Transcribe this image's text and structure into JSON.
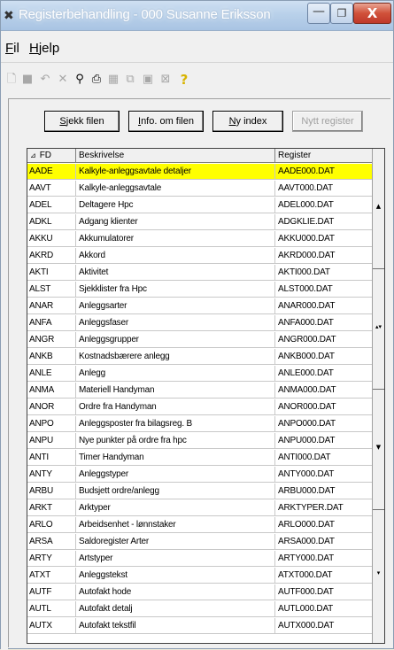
{
  "window": {
    "title": "Registerbehandling - 000 Susanne Eriksson",
    "app_icon": "x-logo-icon",
    "minimize": "—",
    "maximize": "❐",
    "close": "X"
  },
  "menu": {
    "fil_u": "F",
    "fil_rest": "il",
    "hjelp_u": "H",
    "hjelp_rest": "jelp"
  },
  "toolbar": {
    "icons": [
      "new-icon",
      "save-icon",
      "undo-icon",
      "delete-icon",
      "find-icon",
      "print-icon",
      "grid-icon",
      "copy-icon",
      "report-icon",
      "export-icon",
      "help-icon"
    ]
  },
  "buttons": {
    "sjekk_u": "S",
    "sjekk_rest": "jekk filen",
    "info_u": "I",
    "info_rest": "nfo. om filen",
    "index_u": "N",
    "index_rest": "y index",
    "nytt": "Nytt register"
  },
  "grid": {
    "columns": [
      "FD",
      "Beskrivelse",
      "Register"
    ],
    "sort_indicator": "⊿",
    "rows": [
      {
        "fd": "AADE",
        "desc": "Kalkyle-anleggsavtale detaljer",
        "reg": "AADE000.DAT"
      },
      {
        "fd": "AAVT",
        "desc": "Kalkyle-anleggsavtale",
        "reg": "AAVT000.DAT"
      },
      {
        "fd": "ADEL",
        "desc": "Deltagere Hpc",
        "reg": "ADEL000.DAT"
      },
      {
        "fd": "ADKL",
        "desc": "Adgang klienter",
        "reg": "ADGKLIE.DAT"
      },
      {
        "fd": "AKKU",
        "desc": "Akkumulatorer",
        "reg": "AKKU000.DAT"
      },
      {
        "fd": "AKRD",
        "desc": "Akkord",
        "reg": "AKRD000.DAT"
      },
      {
        "fd": "AKTI",
        "desc": "Aktivitet",
        "reg": "AKTI000.DAT"
      },
      {
        "fd": "ALST",
        "desc": "Sjekklister fra Hpc",
        "reg": "ALST000.DAT"
      },
      {
        "fd": "ANAR",
        "desc": "Anleggsarter",
        "reg": "ANAR000.DAT"
      },
      {
        "fd": "ANFA",
        "desc": "Anleggsfaser",
        "reg": "ANFA000.DAT"
      },
      {
        "fd": "ANGR",
        "desc": "Anleggsgrupper",
        "reg": "ANGR000.DAT"
      },
      {
        "fd": "ANKB",
        "desc": "Kostnadsbærere anlegg",
        "reg": "ANKB000.DAT"
      },
      {
        "fd": "ANLE",
        "desc": "Anlegg",
        "reg": "ANLE000.DAT"
      },
      {
        "fd": "ANMA",
        "desc": "Materiell Handyman",
        "reg": "ANMA000.DAT"
      },
      {
        "fd": "ANOR",
        "desc": "Ordre fra Handyman",
        "reg": "ANOR000.DAT"
      },
      {
        "fd": "ANPO",
        "desc": "Anleggsposter fra bilagsreg. B",
        "reg": "ANPO000.DAT"
      },
      {
        "fd": "ANPU",
        "desc": "Nye punkter på ordre fra hpc",
        "reg": "ANPU000.DAT"
      },
      {
        "fd": "ANTI",
        "desc": "Timer Handyman",
        "reg": "ANTI000.DAT"
      },
      {
        "fd": "ANTY",
        "desc": "Anleggstyper",
        "reg": "ANTY000.DAT"
      },
      {
        "fd": "ARBU",
        "desc": "Budsjett ordre/anlegg",
        "reg": "ARBU000.DAT"
      },
      {
        "fd": "ARKT",
        "desc": "Arktyper",
        "reg": "ARKTYPER.DAT"
      },
      {
        "fd": "ARLO",
        "desc": "Arbeidsenhet - lønnstaker",
        "reg": "ARLO000.DAT"
      },
      {
        "fd": "ARSA",
        "desc": "Saldoregister Arter",
        "reg": "ARSA000.DAT"
      },
      {
        "fd": "ARTY",
        "desc": "Artstyper",
        "reg": "ARTY000.DAT"
      },
      {
        "fd": "ATXT",
        "desc": "Anleggstekst",
        "reg": "ATXT000.DAT"
      },
      {
        "fd": "AUTF",
        "desc": "Autofakt hode",
        "reg": "AUTF000.DAT"
      },
      {
        "fd": "AUTL",
        "desc": "Autofakt detalj",
        "reg": "AUTL000.DAT"
      },
      {
        "fd": "AUTX",
        "desc": "Autofakt tekstfil",
        "reg": "AUTX000.DAT"
      }
    ],
    "selected_row": 0
  },
  "scroll": {
    "marks": [
      "▲",
      "▴▾",
      "▼",
      "▾"
    ]
  },
  "colors": {
    "selected_row": "#ffff00",
    "close_button": "#c0392b",
    "help_icon": "#d8b400"
  }
}
